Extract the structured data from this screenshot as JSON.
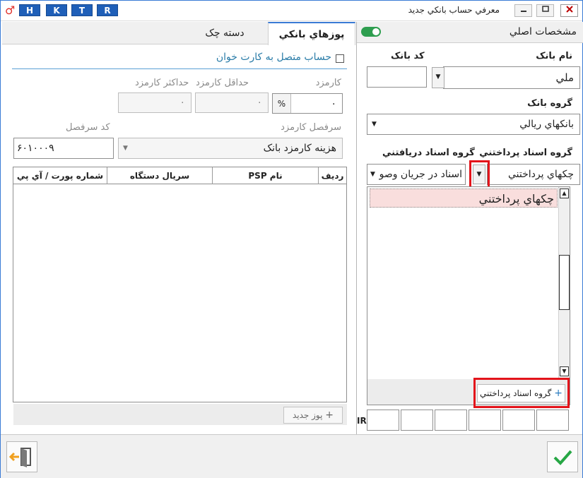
{
  "window": {
    "title": "معرفي حساب بانکي جديد",
    "hotkeys": [
      "H",
      "K",
      "T",
      "R"
    ]
  },
  "right_panel": {
    "header": "مشخصات اصلي",
    "bank_name_label": "نام بانک",
    "bank_name_value": "ملي",
    "bank_code_label": "کد بانک",
    "bank_code_value": "",
    "bank_group_label": "گروه بانک",
    "bank_group_value": "بانکهاي ريالي",
    "pay_docs_label": "گروه اسناد پرداختني",
    "pay_docs_value": "چکهاي پرداختني",
    "recv_docs_label": "گروه اسناد دريافتني",
    "recv_docs_value": "اسناد در جريان وصو",
    "list_items": [
      "چکهاي پرداختني"
    ],
    "add_pay_group_label": "گروه اسناد پرداختني",
    "iban_prefix": "IR"
  },
  "left_panel": {
    "tabs": [
      "پوزهاي بانکي",
      "دسته چک"
    ],
    "card_reader_label": "حساب متصل به کارت خوان",
    "fee_label": "کارمزد",
    "fee_value": "۰",
    "fee_unit": "%",
    "min_fee_label": "حداقل کارمزد",
    "min_fee_value": "۰",
    "max_fee_label": "حداکثر کارمزد",
    "max_fee_value": "۰",
    "fee_ledger_label": "سرفصل کارمزد",
    "fee_ledger_value": "هزينه کارمزد بانک",
    "ledger_code_label": "کد سرفصل",
    "ledger_code_value": "۶۰۱۰۰۰۹",
    "table_headers": [
      "رديف",
      "نام PSP",
      "سريال دستگاه",
      "شماره پورت / آي پي"
    ],
    "new_pos_label": "پوز جديد"
  },
  "colors": {
    "accent": "#3a7bd5",
    "highlight_row": "#f9dedd",
    "red_marker": "#e3141b",
    "toggle_green": "#2e9e4f",
    "confirm_green": "#27a745"
  }
}
